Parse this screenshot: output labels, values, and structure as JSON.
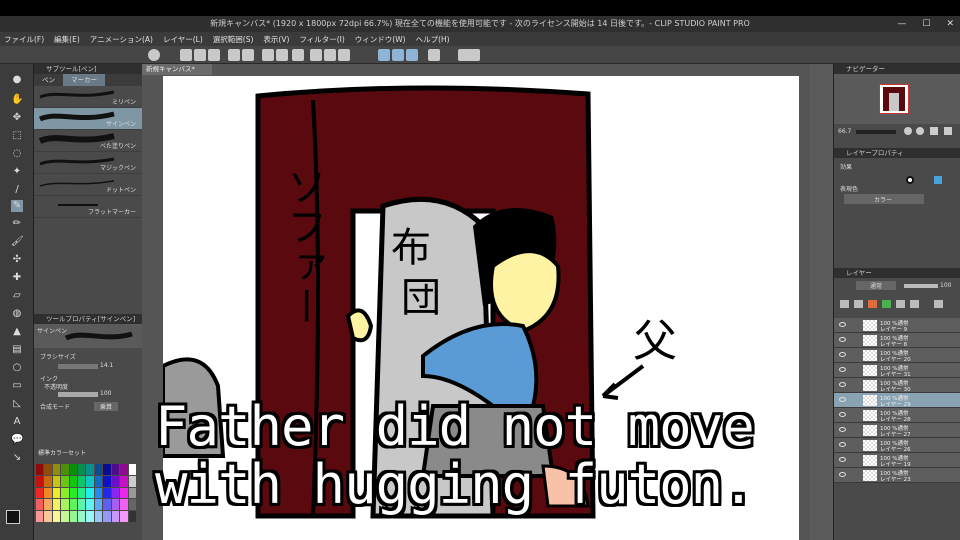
{
  "window": {
    "title": "新規キャンバス* (1920 x 1800px 72dpi 66.7%)  現在全ての機能を使用可能です - 次のライセンス開始は 14 日後です。- CLIP STUDIO PAINT PRO",
    "min": "—",
    "max": "☐",
    "close": "✕"
  },
  "menu": [
    "ファイル(F)",
    "編集(E)",
    "アニメーション(A)",
    "レイヤー(L)",
    "選択範囲(S)",
    "表示(V)",
    "フィルター(I)",
    "ウィンドウ(W)",
    "ヘルプ(H)"
  ],
  "subtool": {
    "header": "サブツール[ペン]",
    "tabs": [
      "ペン",
      "マーカー"
    ],
    "brushes": [
      "ミリペン",
      "サインペン",
      "べた塗りペン",
      "マジックペン",
      "ドットペン",
      "フラットマーカー"
    ],
    "selected_index": 1
  },
  "tool_property": {
    "header": "ツールプロパティ[サインペン]",
    "brush_name": "サインペン",
    "size_label": "ブラシサイズ",
    "size_value": "14.1",
    "ink_label": "インク",
    "opacity_label": "不透明度",
    "opacity_value": "100",
    "blend_label": "合成モード",
    "blend_value": "乗算"
  },
  "color_set": {
    "label": "標準カラーセット"
  },
  "canvas": {
    "tab": "新規キャンバス*",
    "zoom": "66.7"
  },
  "navigator": {
    "header": "ナビゲーター",
    "zoom": "66.7"
  },
  "layer_property": {
    "header": "レイヤープロパティ",
    "effect_label": "効果",
    "expression_label": "表現色",
    "color_value": "カラー"
  },
  "layers": {
    "header": "レイヤー",
    "blend": "通常",
    "opacity": "100",
    "rows": [
      {
        "t1": "100 %通常",
        "t2": "レイヤー 9"
      },
      {
        "t1": "100 %通常",
        "t2": "レイヤー 8"
      },
      {
        "t1": "100 %通常",
        "t2": "レイヤー 20"
      },
      {
        "t1": "100 %通常",
        "t2": "レイヤー 31"
      },
      {
        "t1": "100 %通常",
        "t2": "レイヤー 30"
      },
      {
        "t1": "100 %通常",
        "t2": "レイヤー 29"
      },
      {
        "t1": "100 %通常",
        "t2": "レイヤー 28"
      },
      {
        "t1": "100 %通常",
        "t2": "レイヤー 27"
      },
      {
        "t1": "100 %通常",
        "t2": "レイヤー 26"
      },
      {
        "t1": "100 %通常",
        "t2": "レイヤー 19"
      },
      {
        "t1": "100 %通常",
        "t2": "レイヤー 23"
      }
    ],
    "selected_index": 5
  },
  "drawing": {
    "sofa_text": "ソファー",
    "futon_text_1": "布",
    "futon_text_2": "団",
    "father_text": "父"
  },
  "subtitle": {
    "line1": "Father did not move",
    "line2": "with hugging futon."
  },
  "colors": {
    "sofa": "#5a0a0f",
    "futon": "#c8c8c8",
    "shirt": "#5b9bd5",
    "skin": "#fff3a3",
    "selection": "#8aa3b3"
  }
}
